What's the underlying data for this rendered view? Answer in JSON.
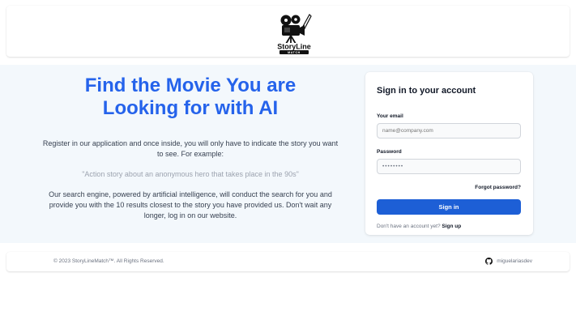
{
  "header": {
    "logo_text": "StoryLine",
    "logo_subtext": "MATCH"
  },
  "hero": {
    "title": "Find the Movie You are Looking for with AI",
    "intro": "Register in our application and once inside, you will only have to indicate the story you want to see. For example:",
    "example": "\"Action story about an anonymous hero that takes place in the 90s\"",
    "description": "Our search engine, powered by artificial intelligence, will conduct the search for you and provide you with the 10 results closest to the story you have provided us. Don't wait any longer, log in on our website."
  },
  "signin": {
    "title": "Sign in to your account",
    "email_label": "Your email",
    "email_placeholder": "name@company.com",
    "password_label": "Password",
    "password_value": "••••••••",
    "forgot": "Forgot password?",
    "button": "Sign in",
    "no_account": "Don't have an account yet?",
    "signup": "Sign up"
  },
  "footer": {
    "copyright": "© 2023 StoryLineMatch™. All Rights Reserved.",
    "github_user": "miguelariasdev"
  },
  "colors": {
    "accent": "#2563eb",
    "button": "#1d5fd6",
    "hero_bg": "#f3f8fc"
  }
}
